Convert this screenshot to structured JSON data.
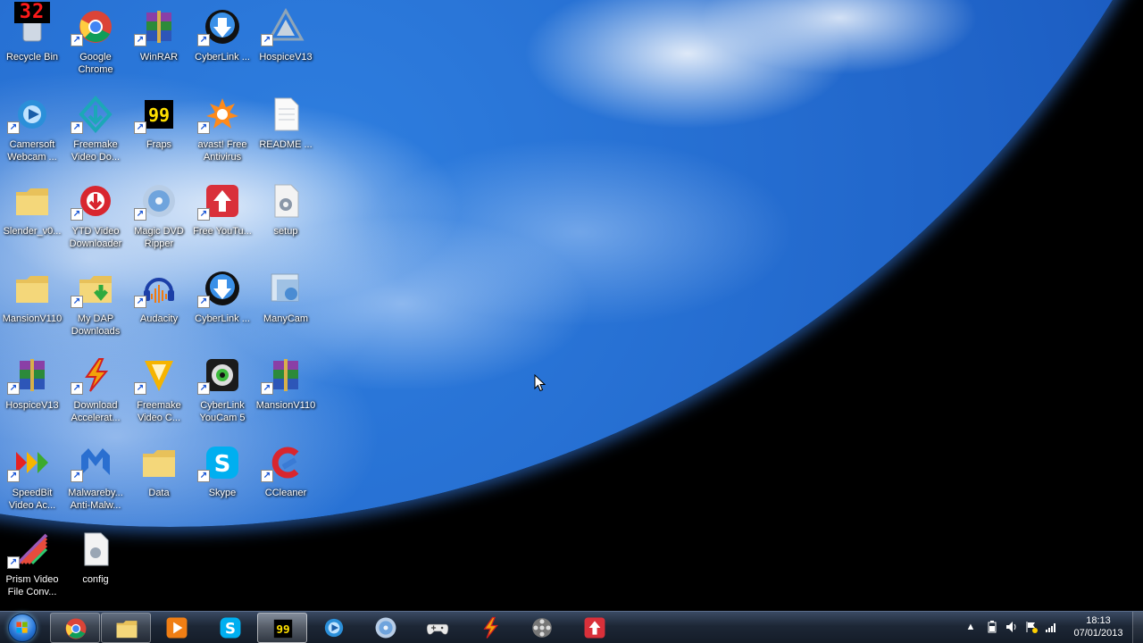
{
  "overlay": {
    "fps_counter": "32"
  },
  "desktop": {
    "icons": [
      {
        "label": "Recycle Bin",
        "icon": "recycle-bin-icon"
      },
      {
        "label": "Google Chrome",
        "icon": "chrome-icon"
      },
      {
        "label": "WinRAR",
        "icon": "winrar-icon"
      },
      {
        "label": "CyberLink ...",
        "icon": "cyberlink-icon"
      },
      {
        "label": "HospiceV13",
        "icon": "hospice-icon"
      },
      {
        "label": "Camersoft Webcam ...",
        "icon": "camersoft-icon"
      },
      {
        "label": "Freemake Video Do...",
        "icon": "freemake-downloader-icon"
      },
      {
        "label": "Fraps",
        "icon": "fraps-icon"
      },
      {
        "label": "avast! Free Antivirus",
        "icon": "avast-icon"
      },
      {
        "label": "README ...",
        "icon": "document-icon"
      },
      {
        "label": "Slender_v0...",
        "icon": "folder-icon"
      },
      {
        "label": "YTD Video Downloader",
        "icon": "ytd-icon"
      },
      {
        "label": "Magic DVD Ripper",
        "icon": "dvd-ripper-icon"
      },
      {
        "label": "Free YouTu...",
        "icon": "free-youtube-icon"
      },
      {
        "label": "setup",
        "icon": "setup-file-icon"
      },
      {
        "label": "MansionV110",
        "icon": "folder-icon"
      },
      {
        "label": "My DAP Downloads",
        "icon": "dap-folder-icon"
      },
      {
        "label": "Audacity",
        "icon": "audacity-icon"
      },
      {
        "label": "CyberLink ...",
        "icon": "cyberlink-icon"
      },
      {
        "label": "ManyCam",
        "icon": "manycam-icon"
      },
      {
        "label": "HospiceV13",
        "icon": "winrar-icon"
      },
      {
        "label": "Download Accelerat...",
        "icon": "dap-icon"
      },
      {
        "label": "Freemake Video C...",
        "icon": "freemake-converter-icon"
      },
      {
        "label": "CyberLink YouCam 5",
        "icon": "youcam-icon"
      },
      {
        "label": "MansionV110",
        "icon": "winrar-icon"
      },
      {
        "label": "SpeedBit Video Ac...",
        "icon": "speedbit-icon"
      },
      {
        "label": "Malwareby... Anti-Malw...",
        "icon": "malwarebytes-icon"
      },
      {
        "label": "Data",
        "icon": "folder-icon"
      },
      {
        "label": "Skype",
        "icon": "skype-icon"
      },
      {
        "label": "CCleaner",
        "icon": "ccleaner-icon"
      },
      {
        "label": "Prism Video File Conv...",
        "icon": "prism-icon"
      },
      {
        "label": "config",
        "icon": "config-file-icon"
      }
    ]
  },
  "taskbar": {
    "items": [
      {
        "name": "taskbar-chrome",
        "icon": "chrome-icon",
        "state": "pinned"
      },
      {
        "name": "taskbar-explorer",
        "icon": "folder-icon",
        "state": "pinned"
      },
      {
        "name": "taskbar-media-player",
        "icon": "media-player-icon",
        "state": "normal"
      },
      {
        "name": "taskbar-skype",
        "icon": "skype-icon",
        "state": "normal"
      },
      {
        "name": "taskbar-fraps",
        "icon": "fraps-icon",
        "state": "active"
      },
      {
        "name": "taskbar-camersoft",
        "icon": "camersoft-icon",
        "state": "normal"
      },
      {
        "name": "taskbar-dvd-ripper",
        "icon": "dvd-ripper-icon",
        "state": "normal"
      },
      {
        "name": "taskbar-gamepad",
        "icon": "gamepad-icon",
        "state": "normal"
      },
      {
        "name": "taskbar-dap",
        "icon": "dap-icon",
        "state": "normal"
      },
      {
        "name": "taskbar-video-tool",
        "icon": "film-reel-icon",
        "state": "normal"
      },
      {
        "name": "taskbar-free-youtube",
        "icon": "free-youtube-icon",
        "state": "normal"
      }
    ],
    "clock": {
      "time": "18:13",
      "date": "07/01/2013"
    }
  }
}
